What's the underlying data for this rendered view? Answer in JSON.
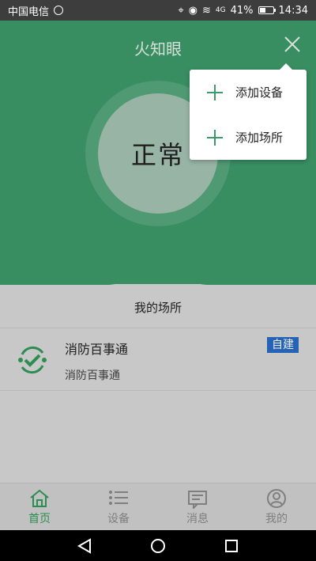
{
  "status_bar": {
    "carrier": "中国电信",
    "signal_text": "4G",
    "battery": "41%",
    "battery_level": 0.41,
    "time": "14:34"
  },
  "header": {
    "title": "火知眼"
  },
  "status_circle": {
    "text": "正常"
  },
  "popup_menu": {
    "items": [
      {
        "label": "添加设备",
        "icon": "plus-icon"
      },
      {
        "label": "添加场所",
        "icon": "plus-icon"
      }
    ]
  },
  "section": {
    "title": "我的场所"
  },
  "places": [
    {
      "name": "消防百事通",
      "subtitle": "消防百事通",
      "badge": "自建",
      "icon": "check-circle-icon"
    }
  ],
  "bottom_nav": {
    "items": [
      {
        "label": "首页",
        "icon": "home-icon",
        "active": true
      },
      {
        "label": "设备",
        "icon": "list-icon",
        "active": false
      },
      {
        "label": "消息",
        "icon": "message-icon",
        "active": false
      },
      {
        "label": "我的",
        "icon": "user-icon",
        "active": false
      }
    ]
  },
  "colors": {
    "accent": "#3d9a6a",
    "active_nav": "#2f9a57",
    "badge": "#2b6cc4"
  }
}
